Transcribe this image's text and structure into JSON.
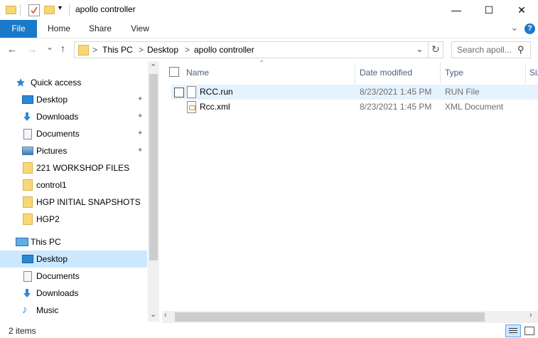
{
  "window": {
    "title": "apollo controller",
    "min_glyph": "—",
    "max_glyph": "☐",
    "close_glyph": "✕"
  },
  "ribbon": {
    "tabs": [
      "File",
      "Home",
      "Share",
      "View"
    ],
    "expand_glyph": "⌄",
    "help_glyph": "?"
  },
  "address": {
    "back_glyph": "←",
    "forward_glyph": "→",
    "recent_glyph": "⌄",
    "up_glyph": "↑",
    "crumbs": [
      "This PC",
      "Desktop",
      "apollo controller"
    ],
    "crumb_sep": ">",
    "dropdown_glyph": "⌄",
    "refresh_glyph": "↻",
    "search_placeholder": "Search apoll...",
    "search_glyph": "⚲"
  },
  "nav": {
    "quick_access": "Quick access",
    "quick_items": [
      {
        "label": "Desktop",
        "icon": "desktop-icon",
        "pinned": true
      },
      {
        "label": "Downloads",
        "icon": "download-icon",
        "pinned": true
      },
      {
        "label": "Documents",
        "icon": "documents-icon",
        "pinned": true
      },
      {
        "label": "Pictures",
        "icon": "pictures-icon",
        "pinned": true
      },
      {
        "label": "221 WORKSHOP FILES",
        "icon": "folder-icon",
        "pinned": false
      },
      {
        "label": "control1",
        "icon": "folder-icon",
        "pinned": false
      },
      {
        "label": "HGP INITIAL SNAPSHOTS",
        "icon": "folder-icon",
        "pinned": false
      },
      {
        "label": "HGP2",
        "icon": "folder-icon",
        "pinned": false
      }
    ],
    "this_pc": "This PC",
    "pc_items": [
      {
        "label": "Desktop",
        "icon": "desktop-icon",
        "selected": true
      },
      {
        "label": "Documents",
        "icon": "documents-icon",
        "selected": false
      },
      {
        "label": "Downloads",
        "icon": "download-icon",
        "selected": false
      },
      {
        "label": "Music",
        "icon": "music-icon",
        "selected": false
      }
    ],
    "pin_glyph": "📌",
    "scroll_up": "⌃",
    "scroll_down": "⌄"
  },
  "columns": {
    "name": "Name",
    "date": "Date modified",
    "type": "Type",
    "size": "Siz",
    "sort_glyph": "⌃"
  },
  "files": [
    {
      "name": "RCC.run",
      "date": "8/23/2021 1:45 PM",
      "type": "RUN File",
      "icon": "file-icon"
    },
    {
      "name": "Rcc.xml",
      "date": "8/23/2021 1:45 PM",
      "type": "XML Document",
      "icon": "xml-file-icon"
    }
  ],
  "status": {
    "count": "2 items"
  },
  "colors": {
    "accent": "#1979ca",
    "hover_row": "#e5f3ff",
    "selected_nav": "#cce8ff",
    "folder": "#f8d775"
  }
}
